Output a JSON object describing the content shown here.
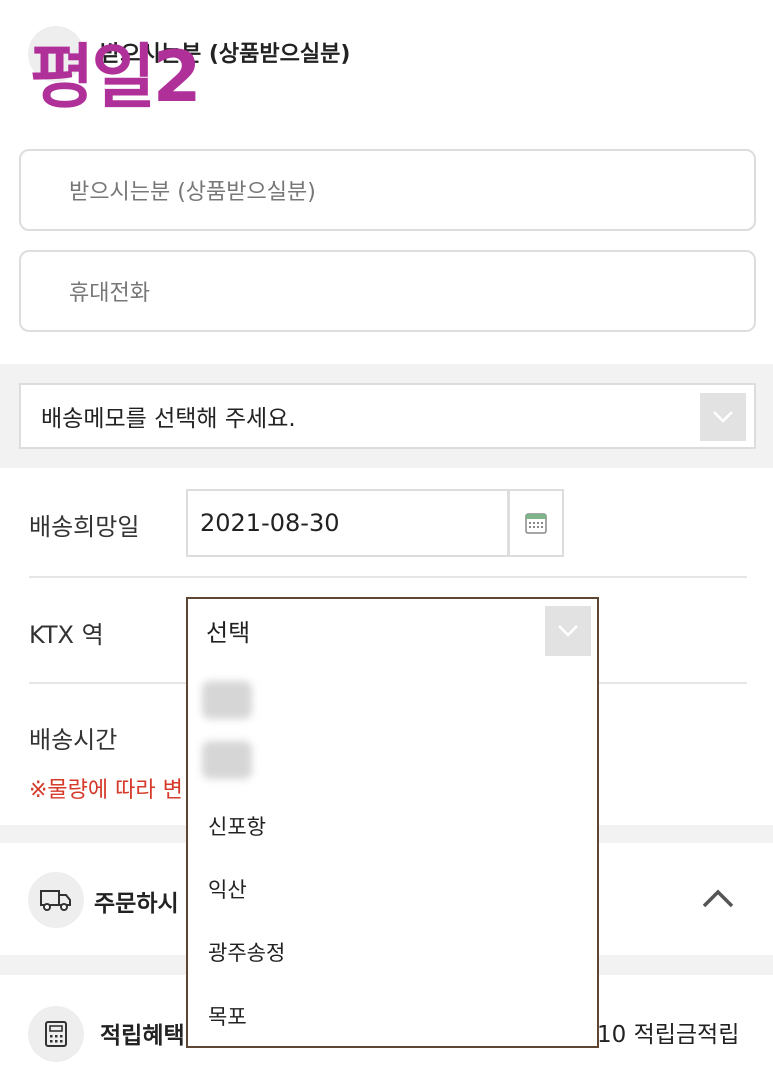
{
  "recipient": {
    "header_title": "받으시는분 (상품받으실분)",
    "overlay_label": "평일2",
    "name_placeholder": "받으시는분 (상품받으실분)",
    "phone_placeholder": "휴대전화"
  },
  "memo": {
    "selected": "배송메모를 선택해 주세요."
  },
  "delivery": {
    "date_label": "배송희망일",
    "date_value": "2021-08-30",
    "ktx_label": "KTX 역",
    "ktx_selected": "선택",
    "ktx_options": [
      "신포항",
      "익산",
      "광주송정",
      "목포"
    ],
    "time_label": "배송시간",
    "note": "※물량에 따라 변"
  },
  "orderer": {
    "title": "주문하시"
  },
  "rewards": {
    "title": "적립혜택",
    "points_tail": "10 적립금적립"
  },
  "colors": {
    "overlay": "#b0309a",
    "note_red": "#d53a2a",
    "dropdown_border": "#5e4633"
  }
}
